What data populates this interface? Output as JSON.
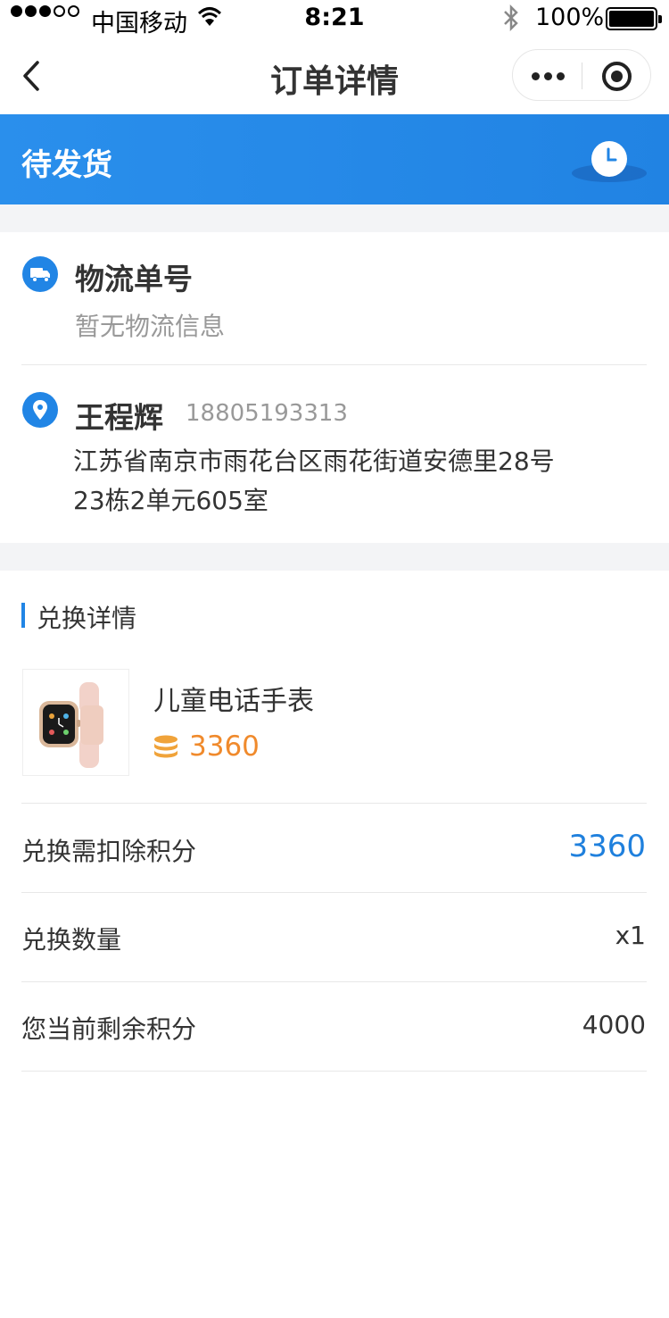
{
  "status_bar": {
    "carrier": "中国移动",
    "time": "8:21",
    "battery": "100%",
    "battery_level": 1.0,
    "signal_bars": 3
  },
  "nav": {
    "title": "订单详情",
    "back_icon": "chevron-left-icon",
    "more_icon": "more-dots-icon",
    "close_icon": "target-icon"
  },
  "order_status": {
    "label": "待发货",
    "icon": "clock-icon"
  },
  "logistics": {
    "title": "物流单号",
    "info": "暂无物流信息",
    "icon": "truck-icon"
  },
  "address": {
    "name": "王程辉",
    "phone": "18805193313",
    "line1": "江苏省南京市雨花台区雨花街道安德里28号",
    "line2": "23栋2单元605室",
    "icon": "location-pin-icon"
  },
  "exchange": {
    "section_title": "兑换详情",
    "product_name": "儿童电话手表",
    "product_points": "3360",
    "coin_icon": "coin-stack-icon",
    "rows": [
      {
        "label": "兑换需扣除积分",
        "value": "3360"
      },
      {
        "label": "兑换数量",
        "value": "x1"
      },
      {
        "label": "您当前剩余积分",
        "value": "4000"
      }
    ]
  },
  "colors": {
    "brand_blue": "#2185e5",
    "points_orange": "#f08a2c",
    "background_gray": "#f3f4f6"
  }
}
